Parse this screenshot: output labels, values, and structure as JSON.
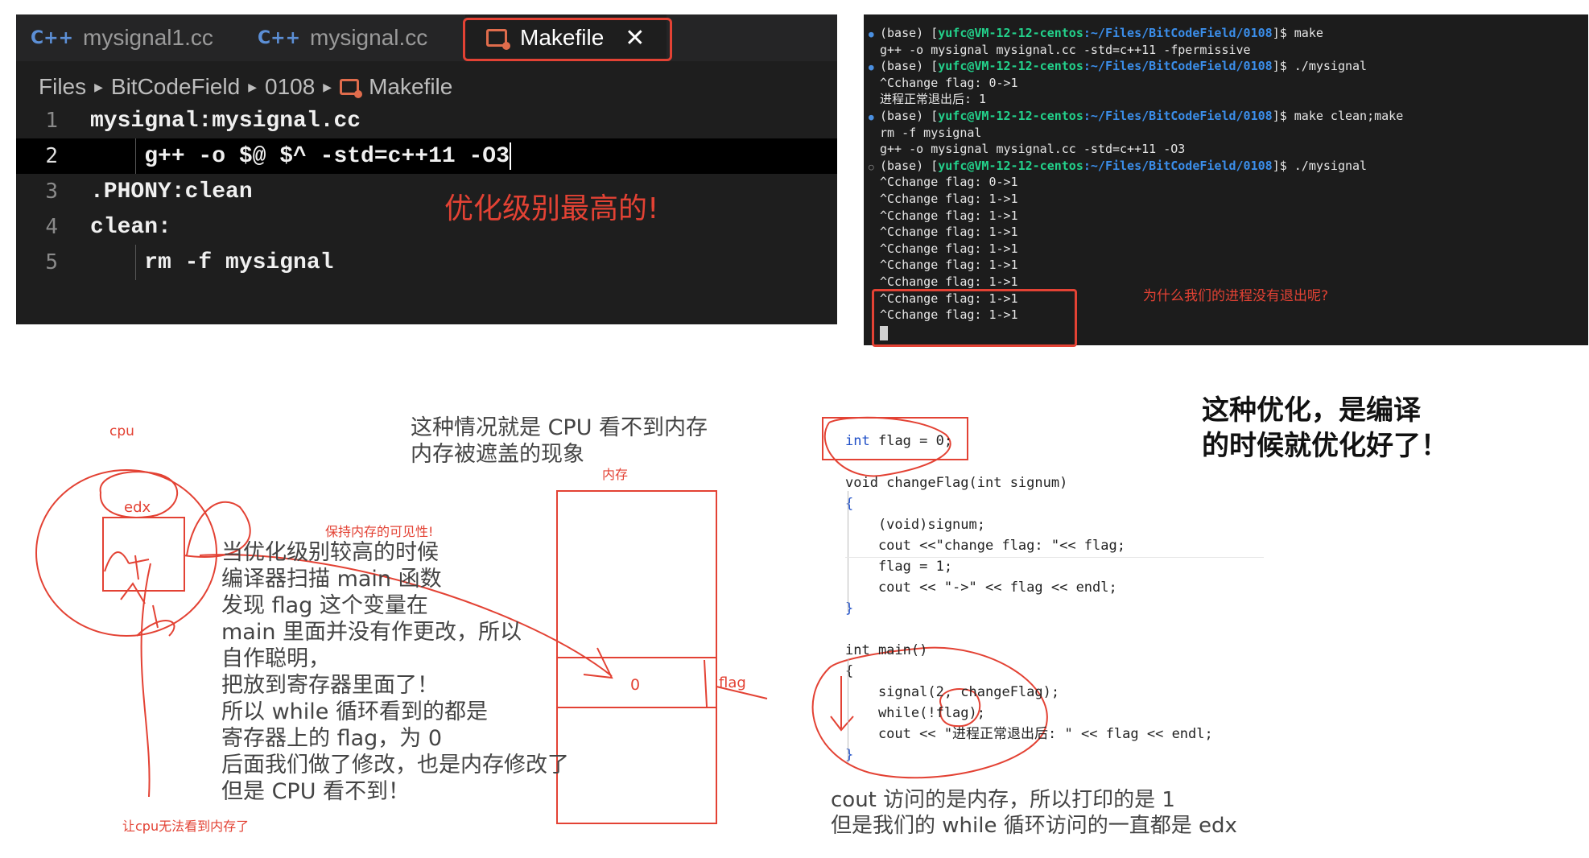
{
  "editor": {
    "tabs": [
      {
        "icon": "C++",
        "label": "mysignal1.cc"
      },
      {
        "icon": "C++",
        "label": "mysignal.cc"
      },
      {
        "label": "Makefile",
        "close": "✕"
      }
    ],
    "breadcrumb": [
      "Files",
      "BitCodeField",
      "0108",
      "Makefile"
    ],
    "lines": [
      {
        "num": "1",
        "text": "mysignal:mysignal.cc"
      },
      {
        "num": "2",
        "text": "    g++ -o $@ $^ -std=c++11 -O3"
      },
      {
        "num": "3",
        "text": ".PHONY:clean"
      },
      {
        "num": "4",
        "text": "clean:"
      },
      {
        "num": "5",
        "text": "    rm -f mysignal"
      }
    ],
    "annotation": "优化级别最高的!"
  },
  "terminal": {
    "prompt_base": "(base) [",
    "userhost": "yufc@VM-12-12-centos",
    "path": ":~/Files/BitCodeField/0108",
    "prompt_end": "]$ ",
    "lines": [
      {
        "type": "prompt",
        "cmd": "make"
      },
      {
        "type": "out",
        "text": "g++ -o mysignal mysignal.cc -std=c++11 -fpermissive"
      },
      {
        "type": "prompt",
        "cmd": "./mysignal"
      },
      {
        "type": "out",
        "text": "^Cchange flag: 0->1"
      },
      {
        "type": "out",
        "text": "进程正常退出后: 1"
      },
      {
        "type": "prompt",
        "cmd": "make clean;make"
      },
      {
        "type": "out",
        "text": "rm -f mysignal"
      },
      {
        "type": "out",
        "text": "g++ -o mysignal mysignal.cc -std=c++11 -O3"
      },
      {
        "type": "prompt2",
        "cmd": "./mysignal"
      },
      {
        "type": "out",
        "text": "^Cchange flag: 0->1"
      },
      {
        "type": "out",
        "text": "^Cchange flag: 1->1"
      },
      {
        "type": "out",
        "text": "^Cchange flag: 1->1"
      },
      {
        "type": "out",
        "text": "^Cchange flag: 1->1"
      },
      {
        "type": "out",
        "text": "^Cchange flag: 1->1"
      },
      {
        "type": "out",
        "text": "^Cchange flag: 1->1"
      },
      {
        "type": "out",
        "text": "^Cchange flag: 1->1"
      },
      {
        "type": "out",
        "text": "^Cchange flag: 1->1"
      },
      {
        "type": "out",
        "text": "^Cchange flag: 1->1"
      }
    ],
    "question": "为什么我们的进程没有退出呢?"
  },
  "diagram": {
    "cpu_label": "cpu",
    "edx_label": "edx",
    "visibility_note": "保持内存的可见性!",
    "cpu_cant_see": "让cpu无法看到内存了",
    "memory_label": "内存",
    "flag_label": "flag",
    "cell_value": "0",
    "heading": [
      "这种情况就是 CPU 看不到内存",
      "内存被遮盖的现象"
    ],
    "explanation": [
      "当优化级别较高的时候",
      "编译器扫描 main 函数",
      "发现 flag 这个变量在",
      "main 里面并没有作更改，所以",
      "自作聪明，",
      "把放到寄存器里面了！",
      "所以 while 循环看到的都是",
      "寄存器上的 flag，为 0",
      "后面我们做了修改，也是内存修改了",
      "但是 CPU 看不到！"
    ]
  },
  "code": {
    "lines": [
      "int flag = 0;",
      "void changeFlag(int signum)",
      "{",
      "    (void)signum;",
      "    cout <<\"change flag: \"<< flag;",
      "    flag = 1;",
      "    cout << \"->\" << flag << endl;",
      "}",
      "int main()",
      "{",
      "    signal(2, changeFlag);",
      "    while(!flag);",
      "    cout << \"进程正常退出后: \" << flag << endl;",
      "}"
    ],
    "bottom_note": [
      "cout 访问的是内存，所以打印的是 1",
      "但是我们的 while 循环访问的一直都是 edx"
    ],
    "side_note": [
      "这种优化，是编译",
      "的时候就优化好了！"
    ]
  },
  "colors": {
    "annotation_red": "#e34234",
    "terminal_bg": "#1c1c1c",
    "editor_bg": "#1e1e1e",
    "path_blue": "#3b8eea",
    "userhost_green": "#23d18b"
  }
}
